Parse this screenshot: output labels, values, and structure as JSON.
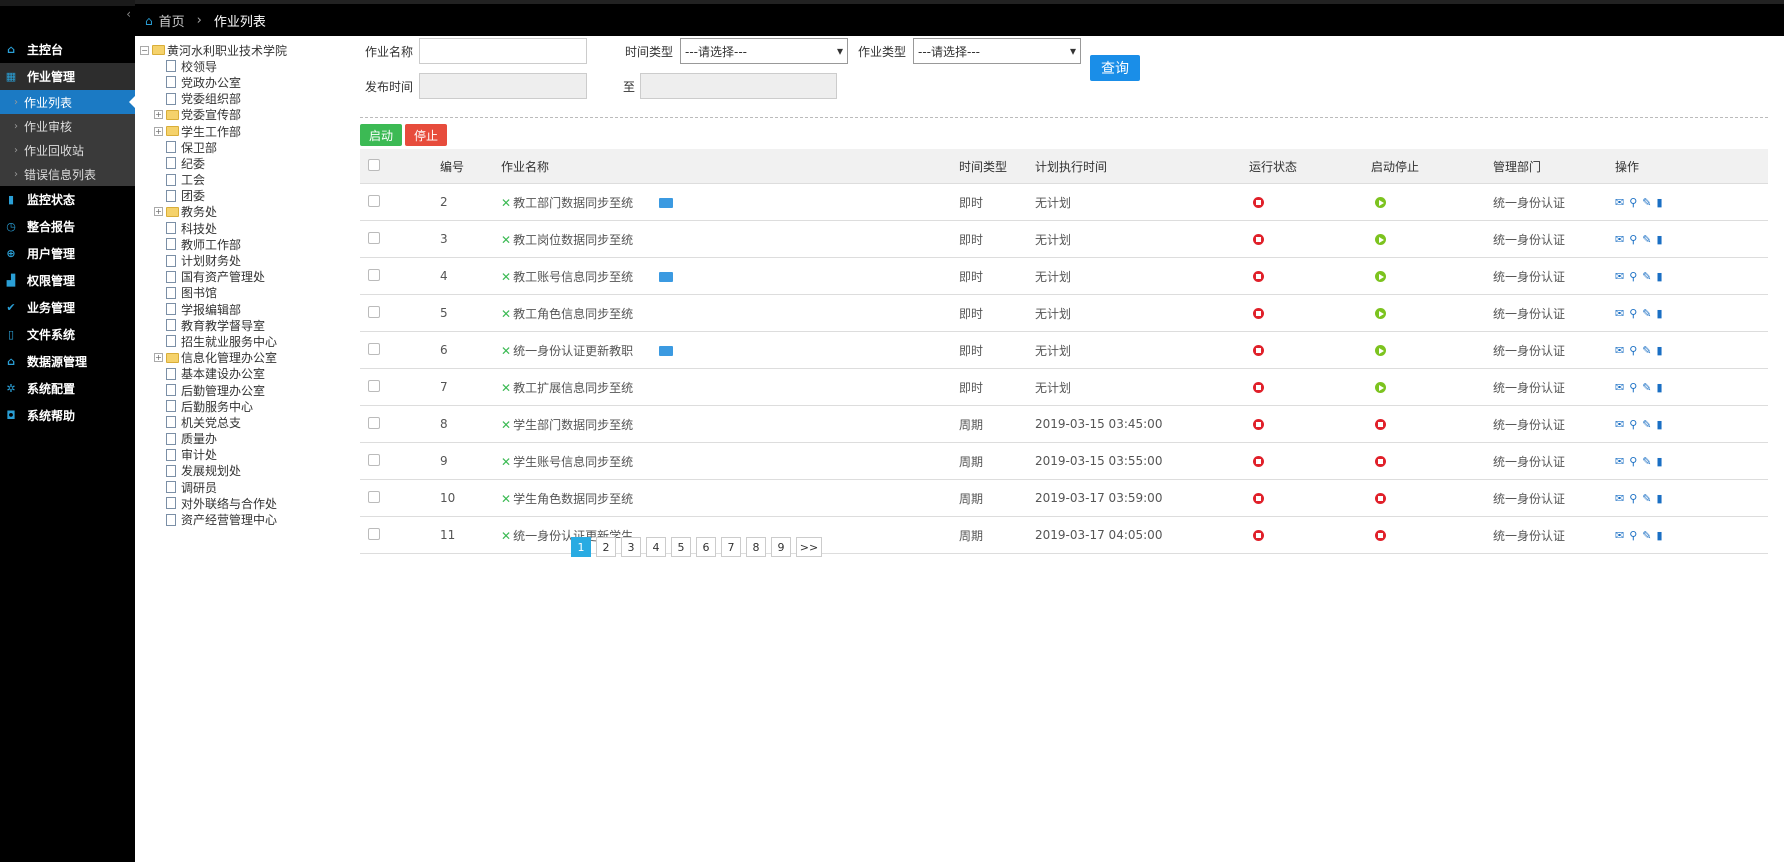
{
  "sidebar": {
    "collapse_glyph": "‹",
    "menu": [
      {
        "label": "主控台",
        "icon": "home-icon",
        "glyph": "⌂"
      },
      {
        "label": "作业管理",
        "icon": "grid-icon",
        "glyph": "▦",
        "open": true,
        "children": [
          {
            "label": "作业列表",
            "active": true
          },
          {
            "label": "作业审核"
          },
          {
            "label": "作业回收站"
          },
          {
            "label": "错误信息列表"
          }
        ]
      },
      {
        "label": "监控状态",
        "icon": "trash-icon",
        "glyph": "▮"
      },
      {
        "label": "整合报告",
        "icon": "clock-icon",
        "glyph": "◷"
      },
      {
        "label": "用户管理",
        "icon": "zoom-icon",
        "glyph": "⊕"
      },
      {
        "label": "权限管理",
        "icon": "signal-icon",
        "glyph": "▟"
      },
      {
        "label": "业务管理",
        "icon": "check-icon",
        "glyph": "✔"
      },
      {
        "label": "文件系统",
        "icon": "file-icon",
        "glyph": "▯"
      },
      {
        "label": "数据源管理",
        "icon": "home-icon",
        "glyph": "⌂"
      },
      {
        "label": "系统配置",
        "icon": "gear-icon",
        "glyph": "✲"
      },
      {
        "label": "系统帮助",
        "icon": "hdd-icon",
        "glyph": "◘"
      }
    ]
  },
  "breadcrumb": {
    "home": "首页",
    "sep": "›",
    "current": "作业列表"
  },
  "tree": {
    "root": "黄河水利职业技术学院",
    "nodes": [
      {
        "label": "校领导",
        "folder": false
      },
      {
        "label": "党政办公室",
        "folder": false
      },
      {
        "label": "党委组织部",
        "folder": false
      },
      {
        "label": "党委宣传部",
        "folder": true
      },
      {
        "label": "学生工作部",
        "folder": true
      },
      {
        "label": "保卫部",
        "folder": false
      },
      {
        "label": "纪委",
        "folder": false
      },
      {
        "label": "工会",
        "folder": false
      },
      {
        "label": "团委",
        "folder": false
      },
      {
        "label": "教务处",
        "folder": true
      },
      {
        "label": "科技处",
        "folder": false
      },
      {
        "label": "教师工作部",
        "folder": false
      },
      {
        "label": "计划财务处",
        "folder": false
      },
      {
        "label": "国有资产管理处",
        "folder": false
      },
      {
        "label": "图书馆",
        "folder": false
      },
      {
        "label": "学报编辑部",
        "folder": false
      },
      {
        "label": "教育教学督导室",
        "folder": false
      },
      {
        "label": "招生就业服务中心",
        "folder": false
      },
      {
        "label": "信息化管理办公室",
        "folder": true
      },
      {
        "label": "基本建设办公室",
        "folder": false
      },
      {
        "label": "后勤管理办公室",
        "folder": false
      },
      {
        "label": "后勤服务中心",
        "folder": false
      },
      {
        "label": "机关党总支",
        "folder": false
      },
      {
        "label": "质量办",
        "folder": false
      },
      {
        "label": "审计处",
        "folder": false
      },
      {
        "label": "发展规划处",
        "folder": false
      },
      {
        "label": "调研员",
        "folder": false
      },
      {
        "label": "对外联络与合作处",
        "folder": false
      },
      {
        "label": "资产经营管理中心",
        "folder": false
      }
    ]
  },
  "filters": {
    "name_label": "作业名称",
    "name_value": "",
    "time_type_label": "时间类型",
    "time_type_value": "---请选择---",
    "job_type_label": "作业类型",
    "job_type_value": "---请选择---",
    "publish_label": "发布时间",
    "to_label": "至",
    "query_label": "查询"
  },
  "actions": {
    "start_label": "启动",
    "stop_label": "停止"
  },
  "table": {
    "headers": {
      "id": "编号",
      "name": "作业名称",
      "time_type": "时间类型",
      "plan_time": "计划执行时间",
      "run_state": "运行状态",
      "start_stop": "启动停止",
      "dept": "管理部门",
      "ops": "操作"
    },
    "rows": [
      {
        "id": "2",
        "name": "教工部门数据同步至统",
        "folder": true,
        "time_type": "即时",
        "plan_time": "无计划",
        "run": "stop",
        "toggle": "start",
        "dept": "统一身份认证"
      },
      {
        "id": "3",
        "name": "教工岗位数据同步至统",
        "folder": false,
        "time_type": "即时",
        "plan_time": "无计划",
        "run": "stop",
        "toggle": "start",
        "dept": "统一身份认证"
      },
      {
        "id": "4",
        "name": "教工账号信息同步至统",
        "folder": true,
        "time_type": "即时",
        "plan_time": "无计划",
        "run": "stop",
        "toggle": "start",
        "dept": "统一身份认证"
      },
      {
        "id": "5",
        "name": "教工角色信息同步至统",
        "folder": false,
        "time_type": "即时",
        "plan_time": "无计划",
        "run": "stop",
        "toggle": "start",
        "dept": "统一身份认证"
      },
      {
        "id": "6",
        "name": "统一身份认证更新教职",
        "folder": true,
        "time_type": "即时",
        "plan_time": "无计划",
        "run": "stop",
        "toggle": "start",
        "dept": "统一身份认证"
      },
      {
        "id": "7",
        "name": "教工扩展信息同步至统",
        "folder": false,
        "time_type": "即时",
        "plan_time": "无计划",
        "run": "stop",
        "toggle": "start",
        "dept": "统一身份认证"
      },
      {
        "id": "8",
        "name": "学生部门数据同步至统",
        "folder": false,
        "time_type": "周期",
        "plan_time": "2019-03-15 03:45:00",
        "run": "stop",
        "toggle": "stop",
        "dept": "统一身份认证"
      },
      {
        "id": "9",
        "name": "学生账号信息同步至统",
        "folder": false,
        "time_type": "周期",
        "plan_time": "2019-03-15 03:55:00",
        "run": "stop",
        "toggle": "stop",
        "dept": "统一身份认证"
      },
      {
        "id": "10",
        "name": "学生角色数据同步至统",
        "folder": false,
        "time_type": "周期",
        "plan_time": "2019-03-17 03:59:00",
        "run": "stop",
        "toggle": "stop",
        "dept": "统一身份认证"
      },
      {
        "id": "11",
        "name": "统一身份认证更新学生",
        "folder": false,
        "time_type": "周期",
        "plan_time": "2019-03-17 04:05:00",
        "run": "stop",
        "toggle": "stop",
        "dept": "统一身份认证"
      }
    ]
  },
  "pager": {
    "pages": [
      "1",
      "2",
      "3",
      "4",
      "5",
      "6",
      "7",
      "8",
      "9"
    ],
    "current": "1",
    "next_label": ">>"
  },
  "colors": {
    "accent": "#1b7ac4",
    "start": "#3cba54",
    "stop": "#e74c3c",
    "query": "#1a8ee8"
  }
}
